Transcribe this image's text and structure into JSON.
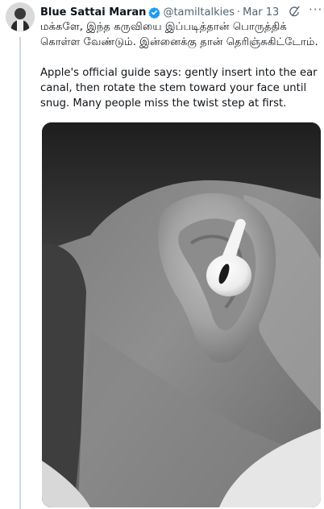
{
  "tweet": {
    "author_name": "Blue Sattai Maran",
    "handle": "@tamiltalkies",
    "separator": "·",
    "date": "Mar 13",
    "more_icon": "···",
    "text_tamil": "மக்களே, இந்த கருவியை இப்படித்தான் பொருத்திக் கொள்ள வேண்டும். இன்னைக்கு தான் தெரிஞ்சுகிட்டோம்.",
    "text_english": "Apple's official guide says: gently insert into the ear canal, then rotate the stem toward your face until snug. Many people miss the twist step at first."
  },
  "colors": {
    "verified": "#1d9bf0",
    "muted": "#536471",
    "thread_line": "#cfd9de"
  },
  "icons": [
    "verified-badge-icon",
    "grok-icon",
    "more-options-icon"
  ]
}
